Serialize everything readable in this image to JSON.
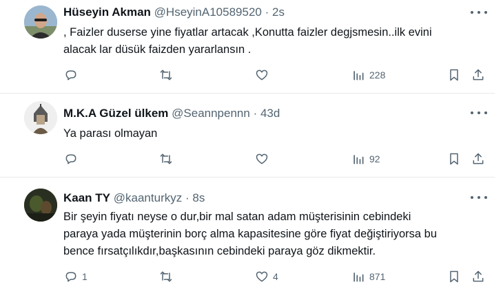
{
  "tweets": [
    {
      "name": "Hüseyin Akman",
      "handle": "@HseyinA10589520",
      "sep": "·",
      "time": "2s",
      "line1": ",  Faizler duserse yine  fiyatlar artacak ,Konutta faizler degjsmesin..ilk evini",
      "line2": "alacak lar düsük faizden yararlansın .",
      "replies": "",
      "retweets": "",
      "likes": "",
      "views": "228",
      "avatar_icon": "man-with-sunglasses-avatar"
    },
    {
      "name": "M.K.A Güzel ülkem",
      "handle": "@Seannpennn",
      "sep": "·",
      "time": "43d",
      "line1": "Ya parası olmayan",
      "replies": "",
      "retweets": "",
      "likes": "",
      "views": "92",
      "avatar_icon": "warrior-helmet-avatar"
    },
    {
      "name": "Kaan TY",
      "handle": "@kaanturkyz",
      "sep": "·",
      "time": "8s",
      "line1": "Bir şeyin fiyatı neyse o dur,bir mal satan adam müşterisinin cebindeki",
      "line2": "paraya yada müşterinin borç alma kapasitesine göre fiyat değiştiriyorsa bu",
      "line3": "bence fırsatçılıkdır,başkasının cebindeki paraya göz dikmektir.",
      "replies": "1",
      "retweets": "",
      "likes": "4",
      "views": "871",
      "avatar_icon": "dark-photo-avatar"
    }
  ],
  "colors": {
    "text": "#0f1419",
    "muted": "#536471",
    "divider": "#e7e9eb"
  }
}
